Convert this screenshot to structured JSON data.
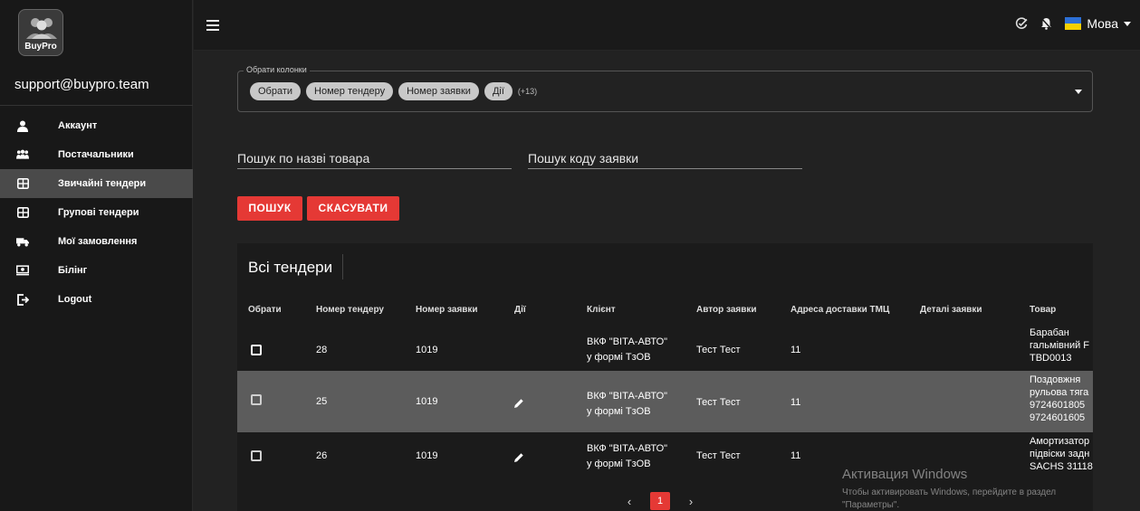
{
  "sidebar": {
    "logo_text": "BuyPro",
    "email": "support@buypro.team",
    "items": [
      {
        "label": "Аккаунт",
        "icon": "person-icon"
      },
      {
        "label": "Постачальники",
        "icon": "group-icon"
      },
      {
        "label": "Звичайні тендери",
        "icon": "table-icon",
        "active": true
      },
      {
        "label": "Групові тендери",
        "icon": "table-icon"
      },
      {
        "label": "Мої замовлення",
        "icon": "truck-icon"
      },
      {
        "label": "Білінг",
        "icon": "billing-icon"
      },
      {
        "label": "Logout",
        "icon": "logout-icon"
      }
    ]
  },
  "topbar": {
    "language_label": "Мова"
  },
  "columns_select": {
    "legend": "Обрати колонки",
    "chips": [
      "Обрати",
      "Номер тендеру",
      "Номер заявки",
      "Дії"
    ],
    "more": "(+13)"
  },
  "search": {
    "product_placeholder": "Пошук по назві товара",
    "code_placeholder": "Пошук коду заявки"
  },
  "buttons": {
    "search": "ПОШУК",
    "cancel": "СКАСУВАТИ"
  },
  "table": {
    "title": "Всі тендери",
    "headers": [
      "Обрати",
      "Номер тендеру",
      "Номер заявки",
      "Дії",
      "Клієнт",
      "Автор заявки",
      "Адреса доставки ТМЦ",
      "Деталі заявки",
      "Товар"
    ],
    "rows": [
      {
        "tender": "28",
        "request": "1019",
        "client_1": "ВКФ \"ВІТА-АВТО\"",
        "client_2": "у формі ТзОВ",
        "author": "Тест Тест",
        "address": "11",
        "product": [
          "Барабан",
          "гальмівний F",
          "TBD0013"
        ],
        "editable": false
      },
      {
        "tender": "25",
        "request": "1019",
        "client_1": "ВКФ \"ВІТА-АВТО\"",
        "client_2": "у формі ТзОВ",
        "author": "Тест Тест",
        "address": "11",
        "product": [
          "Поздовжня",
          "рульова тяга",
          "9724601805",
          "9724601605"
        ],
        "editable": true
      },
      {
        "tender": "26",
        "request": "1019",
        "client_1": "ВКФ \"ВІТА-АВТО\"",
        "client_2": "у формі ТзОВ",
        "author": "Тест Тест",
        "address": "11",
        "product": [
          "Амортизатор",
          "підвіски задн",
          "SACHS 31118"
        ],
        "editable": true
      }
    ]
  },
  "pagination": {
    "current": "1"
  },
  "watermark": {
    "title": "Активация Windows",
    "text": "Чтобы активировать Windows, перейдите в раздел \"Параметры\"."
  }
}
